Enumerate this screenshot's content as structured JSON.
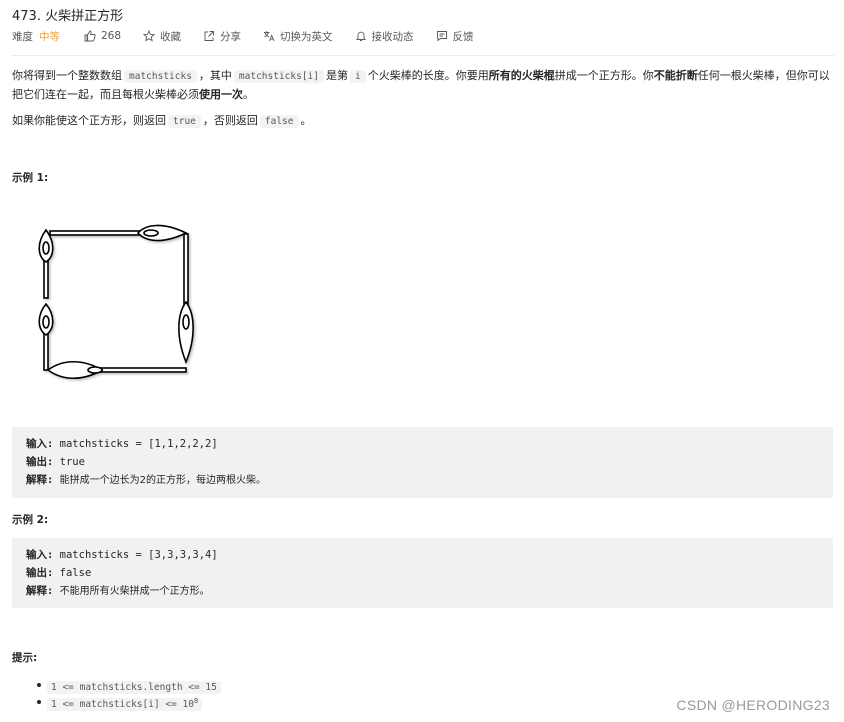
{
  "problem": {
    "title": "473. 火柴拼正方形",
    "difficulty_label": "难度",
    "difficulty_value": "中等",
    "difficulty_color": "#ffa116",
    "likes": "268",
    "collect_label": "收藏",
    "share_label": "分享",
    "switch_lang_label": "切换为英文",
    "notify_label": "接收动态",
    "feedback_label": "反馈"
  },
  "description": {
    "p1_seg1": "你将得到一个整数数组",
    "p1_code1": "matchsticks",
    "p1_seg2": "，其中",
    "p1_code2": "matchsticks[i]",
    "p1_seg3": "是第",
    "p1_code3": "i",
    "p1_seg4": "个火柴棒的长度。你要用",
    "p1_bold1": "所有的火柴棍",
    "p1_seg5": "拼成一个正方形。你",
    "p1_bold2": "不能折断",
    "p1_seg6": "任何一根火柴棒，但你可以把它们连在一起，而且每根火柴棒必须",
    "p1_bold3": "使用一次",
    "p1_seg7": "。",
    "p2_seg1": "如果你能使这个正方形，则返回",
    "p2_code1": "true",
    "p2_seg2": "，否则返回",
    "p2_code2": "false",
    "p2_seg3": "。"
  },
  "examples": [
    {
      "heading": "示例 1:",
      "input_label": "输入:",
      "input_value": "matchsticks = [1,1,2,2,2]",
      "output_label": "输出:",
      "output_value": "true",
      "explain_label": "解释:",
      "explain_value": "能拼成一个边长为2的正方形，每边两根火柴。"
    },
    {
      "heading": "示例 2:",
      "input_label": "输入:",
      "input_value": "matchsticks = [3,3,3,3,4]",
      "output_label": "输出:",
      "output_value": "false",
      "explain_label": "解释:",
      "explain_value": "不能用所有火柴拼成一个正方形。"
    }
  ],
  "hints": {
    "heading": "提示:",
    "items": [
      "1 <= matchsticks.length <= 15",
      "1 <= matchsticks[i] <= 10"
    ],
    "exponent": "8"
  },
  "watermark": "CSDN @HERODING23"
}
